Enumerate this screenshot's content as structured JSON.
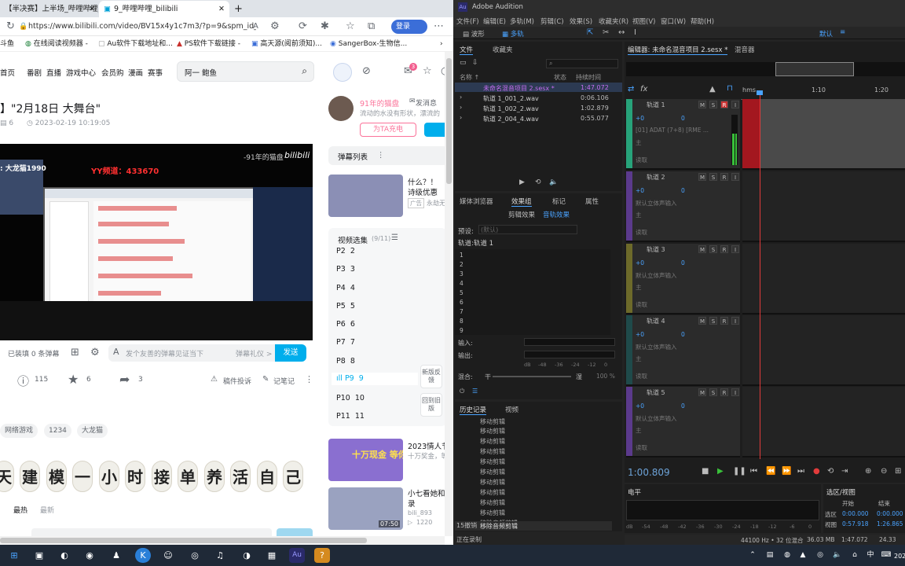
{
  "browser": {
    "tabs": [
      {
        "label": "【半决赛】上半场_哔哩哔哩_b"
      },
      {
        "label": "9_哔哩哔哩_bilibili"
      }
    ],
    "new_tab": "+",
    "address": "https://www.bilibili.com/video/BV15x4y1c7m3/?p=9&spm_id_fro...",
    "login_label": "登录",
    "favorites": [
      "斗鱼",
      "在线阅读视频器 -",
      "Au软件下载地址和...",
      "PS软件下载链接 -",
      "高天源(阅前须知)...",
      "SangerBox-生物信..."
    ]
  },
  "bili": {
    "nav": [
      "首页",
      "番剧",
      "直播",
      "游戏中心",
      "会员购",
      "漫画",
      "赛事"
    ],
    "search_value": "阿一 鲍鱼",
    "badge_count": "3",
    "title": "】\"2月18日 大舞台\"",
    "meta_count": "6",
    "meta_date": "2023-02-19 10:19:05",
    "danmaku_status": "已装填 0 条弹幕",
    "danmaku_placeholder": "发个友善的弹幕见证当下",
    "danmaku_etiquette": "弹幕礼仪 >",
    "send_label": "发送",
    "actions": {
      "coin": "115",
      "fav": "6",
      "share": "3",
      "report": "稿件投诉",
      "note": "记笔记"
    },
    "tags": [
      "网络游戏",
      "1234",
      "大龙猫"
    ],
    "banner_chars": [
      "天",
      "建",
      "模",
      "一",
      "小",
      "时",
      "接",
      "单",
      "养",
      "活",
      "自",
      "己"
    ],
    "comment_tabs": [
      "最热",
      "最新"
    ],
    "player_overlay": {
      "streamer": ": 大龙猫1990",
      "yy": "YY频道：433670",
      "watermark": "-91年的猫盘",
      "bili": "bilibili"
    },
    "up": {
      "name": "91年的猫盘",
      "message": "发消息",
      "desc": "流动的水没有形状，漂流的",
      "charge": "为TA充电"
    },
    "danmaku_list": "弹幕列表",
    "rec1": {
      "title": "什么？！",
      "subtitle": "诗级优惠",
      "ad": "广告",
      "ad_text": "永劫无"
    },
    "episodes_title": "视频选集",
    "episodes_count": "(9/11)",
    "episodes": [
      {
        "p": "P2",
        "n": "2"
      },
      {
        "p": "P3",
        "n": "3"
      },
      {
        "p": "P4",
        "n": "4"
      },
      {
        "p": "P5",
        "n": "5"
      },
      {
        "p": "P6",
        "n": "6"
      },
      {
        "p": "P7",
        "n": "7"
      },
      {
        "p": "P8",
        "n": "8"
      },
      {
        "p": "P9",
        "n": "9"
      },
      {
        "p": "P10",
        "n": "10"
      },
      {
        "p": "P11",
        "n": "11"
      }
    ],
    "side_btns": [
      "新版反馈",
      "回到旧版"
    ],
    "rec2": {
      "title": "2023情人节",
      "subtitle": "十万奖金，等",
      "img_text": "十万现金 等你瓜分"
    },
    "rec3": {
      "title": "小七看她和",
      "title2": "录",
      "author": "bili_893",
      "views": "1220",
      "duration": "07:50"
    }
  },
  "au": {
    "title": "Adobe Audition",
    "menu": [
      "文件(F)",
      "编辑(E)",
      "多轨(M)",
      "剪辑(C)",
      "效果(S)",
      "收藏夹(R)",
      "视图(V)",
      "窗口(W)",
      "帮助(H)"
    ],
    "modes": [
      "波形",
      "多轨"
    ],
    "workspace": "默认",
    "files_tabs": [
      "文件",
      "收藏夹"
    ],
    "files_headers": [
      "名称 ↑",
      "状态",
      "持续时间"
    ],
    "files": [
      {
        "name": "未命名混音项目 2.sesx *",
        "dur": "1:47.072"
      },
      {
        "name": "轨道 1_001_2.wav",
        "dur": "0:06.106"
      },
      {
        "name": "轨道 1_002_2.wav",
        "dur": "1:02.879"
      },
      {
        "name": "轨道 2_004_4.wav",
        "dur": "0:55.077"
      }
    ],
    "editor_tab": "编辑器: 未命名混音项目 2.sesx *",
    "mixer_tab": "混音器",
    "ruler": [
      "hms",
      "1:10",
      "1:20"
    ],
    "tracks": [
      {
        "name": "轨道 1",
        "vol": "+0",
        "pan": "0",
        "input": "[01] ADAT (7+8) [RME ...",
        "out": "主",
        "read": "读取",
        "color": "#27a37a"
      },
      {
        "name": "轨道 2",
        "vol": "+0",
        "pan": "0",
        "input": "默认立体声输入",
        "out": "主",
        "read": "读取",
        "color": "#5b3a8c"
      },
      {
        "name": "轨道 3",
        "vol": "+0",
        "pan": "0",
        "input": "默认立体声输入",
        "out": "主",
        "read": "读取",
        "color": "#6d6a2a"
      },
      {
        "name": "轨道 4",
        "vol": "+0",
        "pan": "0",
        "input": "默认立体声输入",
        "out": "主",
        "read": "读取",
        "color": "#1f4a4a"
      },
      {
        "name": "轨道 5",
        "vol": "+0",
        "pan": "0",
        "input": "默认立体声输入",
        "out": "主",
        "read": "读取",
        "color": "#5b3a8c"
      }
    ],
    "effects_tabs": [
      "媒体浏览器",
      "效果组",
      "标记",
      "属性"
    ],
    "effects_subtabs": [
      "剪辑效果",
      "音轨效果"
    ],
    "preset_label": "预设:",
    "preset_value": "(默认)",
    "rack_title": "轨道:轨道 1",
    "rack_slots": [
      "1",
      "2",
      "3",
      "4",
      "5",
      "6",
      "7",
      "8",
      "9"
    ],
    "input_label": "输入:",
    "output_label": "输出:",
    "mix_label": "混合:",
    "mix_left": "干",
    "mix_right": "湿",
    "mix_pct": "100 %",
    "meter_scale": [
      "dB",
      "-48",
      "-36",
      "-24",
      "-12",
      "0"
    ],
    "history_tabs": [
      "历史记录",
      "视频"
    ],
    "history": [
      "移动剪辑",
      "移动剪辑",
      "移动剪辑",
      "移动剪辑",
      "移动剪辑",
      "移动剪辑",
      "移动剪辑",
      "移动剪辑",
      "移动剪辑",
      "移动剪辑",
      "移除音频剪辑",
      "移除音频剪辑"
    ],
    "undo_count": "15撤销",
    "status_left": "正在录制",
    "timecode": "1:00.809",
    "level_label": "电平",
    "level_scale": [
      "dB",
      "-54",
      "-48",
      "-42",
      "-36",
      "-30",
      "-24",
      "-18",
      "-12",
      "-6",
      "0"
    ],
    "selection_title": "选区/视图",
    "sel_headers": [
      "开始",
      "结束"
    ],
    "sel_rows": [
      {
        "label": "选区",
        "start": "0:00.000",
        "end": "0:00.000"
      },
      {
        "label": "视图",
        "start": "0:57.918",
        "end": "1:26.865"
      }
    ],
    "status": [
      "44100 Hz • 32 位混合",
      "36.03 MB",
      "1:47.072",
      "24.33"
    ]
  },
  "taskbar": {
    "icons": [
      "windows-icon",
      "search-icon",
      "task-view-icon",
      "edge-icon",
      "steam-icon",
      "qq-icon",
      "k-icon",
      "cat-icon",
      "photo-icon",
      "qq-music-icon",
      "audition-icon",
      "help-icon"
    ],
    "au_label": "Au",
    "ime": "中",
    "year": "202"
  }
}
